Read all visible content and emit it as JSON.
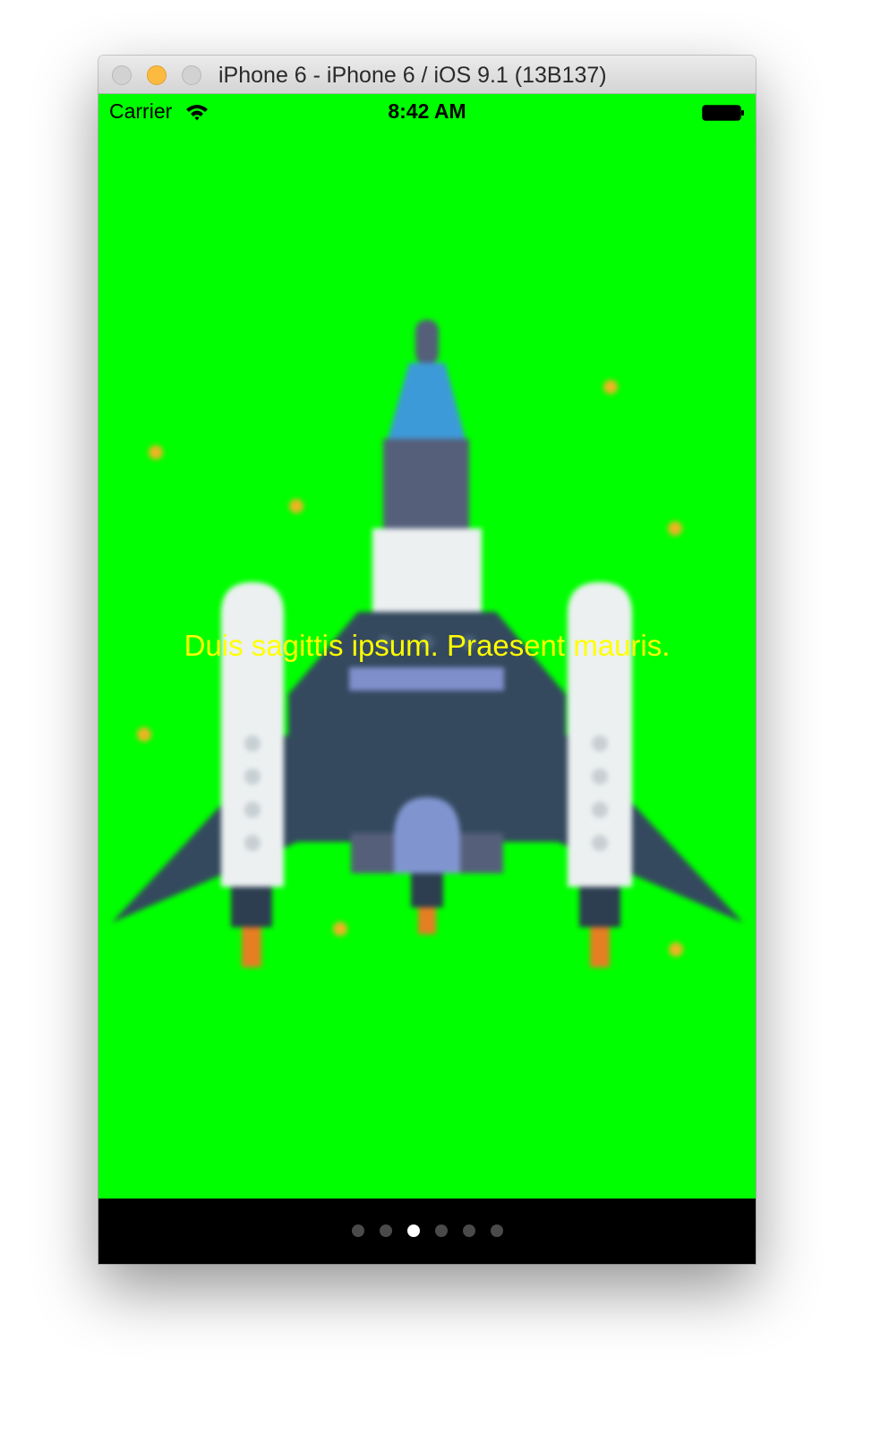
{
  "window": {
    "title": "iPhone 6 - iPhone 6 / iOS 9.1 (13B137)"
  },
  "status_bar": {
    "carrier": "Carrier",
    "time": "8:42 AM",
    "icons": [
      "wifi-icon",
      "battery-icon"
    ]
  },
  "screen": {
    "background_color": "#00ff00",
    "illustration": "rocket-spaceship",
    "caption": "Duis sagittis ipsum. Praesent mauris.",
    "caption_color": "#ffff00"
  },
  "page_control": {
    "page_count": 6,
    "current_page": 3
  }
}
